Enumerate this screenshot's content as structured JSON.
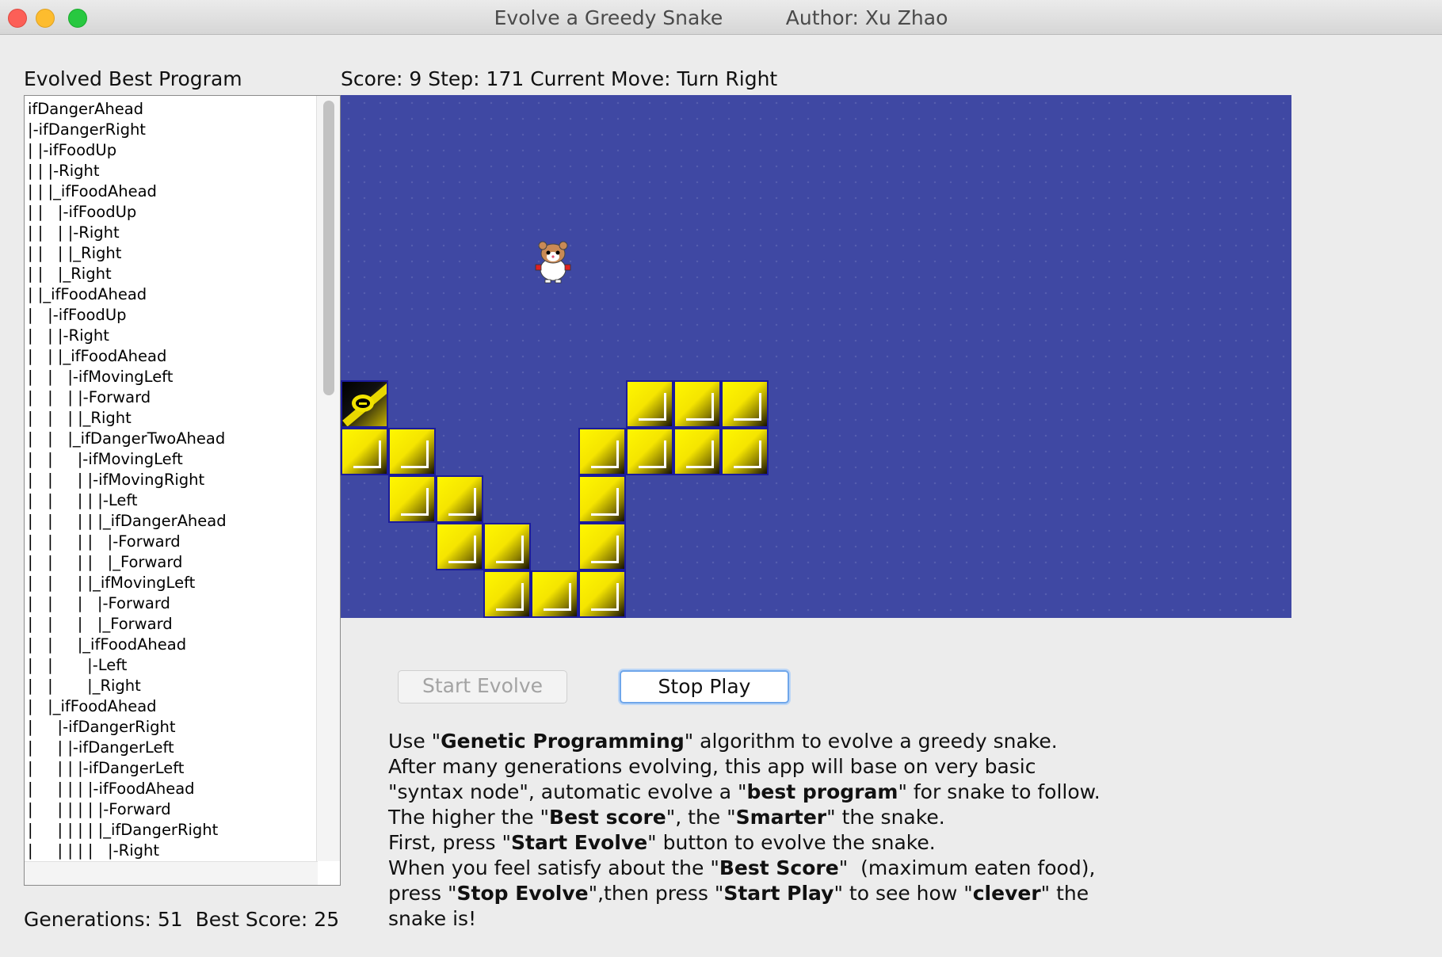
{
  "window": {
    "title": "Evolve a Greedy Snake          Author: Xu Zhao"
  },
  "left_panel": {
    "heading": "Evolved Best Program",
    "tree_lines": [
      "ifDangerAhead",
      "|-ifDangerRight",
      "| |-ifFoodUp",
      "| | |-Right",
      "| | |_ifFoodAhead",
      "| |   |-ifFoodUp",
      "| |   | |-Right",
      "| |   | |_Right",
      "| |   |_Right",
      "| |_ifFoodAhead",
      "|   |-ifFoodUp",
      "|   | |-Right",
      "|   | |_ifFoodAhead",
      "|   |   |-ifMovingLeft",
      "|   |   | |-Forward",
      "|   |   | |_Right",
      "|   |   |_ifDangerTwoAhead",
      "|   |     |-ifMovingLeft",
      "|   |     | |-ifMovingRight",
      "|   |     | | |-Left",
      "|   |     | | |_ifDangerAhead",
      "|   |     | |   |-Forward",
      "|   |     | |   |_Forward",
      "|   |     | |_ifMovingLeft",
      "|   |     |   |-Forward",
      "|   |     |   |_Forward",
      "|   |     |_ifFoodAhead",
      "|   |       |-Left",
      "|   |       |_Right",
      "|   |_ifFoodAhead",
      "|     |-ifDangerRight",
      "|     | |-ifDangerLeft",
      "|     | | |-ifDangerLeft",
      "|     | | | |-ifFoodAhead",
      "|     | | | | |-Forward",
      "|     | | | | |_ifDangerRight",
      "|     | | | |   |-Right"
    ],
    "generations_label": "Generations:",
    "generations": "51",
    "best_score_label": "Best Score:",
    "best_score": "25"
  },
  "status": {
    "text": "Score: 9 Step: 171 Current Move: Turn Right"
  },
  "board": {
    "background_color": "#3f48a3",
    "cell_color": "#f5e500",
    "head_icon": "snake-head-icon",
    "food_icon": "hamster-icon",
    "head": {
      "col": 0,
      "row": 6
    },
    "body": [
      {
        "col": 0,
        "row": 7
      },
      {
        "col": 1,
        "row": 7
      },
      {
        "col": 1,
        "row": 8
      },
      {
        "col": 2,
        "row": 8
      },
      {
        "col": 2,
        "row": 9
      },
      {
        "col": 3,
        "row": 9
      },
      {
        "col": 3,
        "row": 10
      },
      {
        "col": 4,
        "row": 10
      },
      {
        "col": 5,
        "row": 10
      },
      {
        "col": 5,
        "row": 9
      },
      {
        "col": 5,
        "row": 8
      },
      {
        "col": 5,
        "row": 7
      },
      {
        "col": 6,
        "row": 7
      },
      {
        "col": 7,
        "row": 7
      },
      {
        "col": 8,
        "row": 7
      },
      {
        "col": 6,
        "row": 6
      },
      {
        "col": 7,
        "row": 6
      },
      {
        "col": 8,
        "row": 6
      }
    ],
    "food": {
      "col": 4,
      "row": 3
    }
  },
  "buttons": {
    "start_evolve": "Start Evolve",
    "stop_play": "Stop Play"
  },
  "description": {
    "lines": [
      [
        {
          "t": "Use \""
        },
        {
          "t": "Genetic Programming",
          "b": true
        },
        {
          "t": "\" algorithm to evolve a greedy snake."
        }
      ],
      [
        {
          "t": "After many generations evolving, this app will base on very basic"
        }
      ],
      [
        {
          "t": "\"syntax node\", automatic evolve a \""
        },
        {
          "t": "best program",
          "b": true
        },
        {
          "t": "\" for snake to follow."
        }
      ],
      [
        {
          "t": "The higher the \""
        },
        {
          "t": "Best score",
          "b": true
        },
        {
          "t": "\", the \""
        },
        {
          "t": "Smarter",
          "b": true
        },
        {
          "t": "\" the snake."
        }
      ],
      [
        {
          "t": "First, press \""
        },
        {
          "t": "Start Evolve",
          "b": true
        },
        {
          "t": "\" button to evolve the snake."
        }
      ],
      [
        {
          "t": "When you feel satisfy about the \""
        },
        {
          "t": "Best Score",
          "b": true
        },
        {
          "t": "\"  (maximum eaten food),"
        }
      ],
      [
        {
          "t": "press \""
        },
        {
          "t": "Stop Evolve",
          "b": true
        },
        {
          "t": "\",then press \""
        },
        {
          "t": "Start Play",
          "b": true
        },
        {
          "t": "\" to see how \""
        },
        {
          "t": "clever",
          "b": true
        },
        {
          "t": "\" the"
        }
      ],
      [
        {
          "t": "snake is!"
        }
      ]
    ]
  }
}
